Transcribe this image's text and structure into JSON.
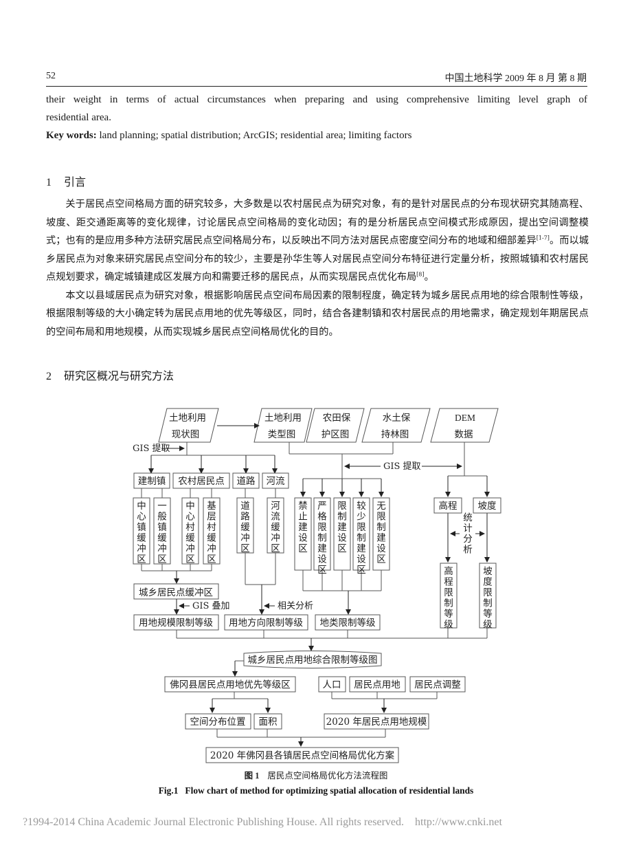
{
  "header": {
    "page_number": "52",
    "journal": "中国土地科学  2009 年 8 月  第 8 期"
  },
  "abstract_tail": {
    "line1": "their weight in terms of actual circumstances when preparing and using comprehensive limiting level graph of",
    "line2": "residential area.",
    "keywords_label": "Key words:",
    "keywords": " land planning; spatial distribution; ArcGIS; residential area; limiting factors"
  },
  "sections": {
    "s1": {
      "number": "1",
      "title": "引言"
    },
    "s2": {
      "number": "2",
      "title": "研究区概况与研究方法"
    }
  },
  "body": {
    "p1_a": "关于居民点空间格局方面的研究较多，大多数是以农村居民点为研究对象，有的是针对居民点的分布现状研究其随高程、坡度、距交通距离等的变化规律，讨论居民点空间格局的变化动因；有的是分析居民点空间模式形成原因，提出空间调整模式；也有的是应用多种方法研究居民点空间格局分布，以反映出不同方法对居民点密度空间分布的地域和细部差异",
    "p1_ref1": "[1-7]",
    "p1_b": "。而以城乡居民点为对象来研究居民点空间分布的较少，主要是孙华生等人对居民点空间分布特征进行定量分析，按照城镇和农村居民点规划要求，确定城镇建成区发展方向和需要迁移的居民点，从而实现居民点优化布局",
    "p1_ref2": "[8]",
    "p1_c": "。",
    "p2": "本文以县域居民点为研究对象，根据影响居民点空间布局因素的限制程度，确定转为城乡居民点用地的综合限制性等级，根据限制等级的大小确定转为居民点用地的优先等级区，同时，结合各建制镇和农村居民点的用地需求，确定规划年期居民点的空间布局和用地规模，从而实现城乡居民点空间格局优化的目的。"
  },
  "flowchart": {
    "inputs": {
      "current_landuse": [
        "土地利用",
        "现状图"
      ],
      "landuse_type": [
        "土地利用",
        "类型图"
      ],
      "farmland": [
        "农田保",
        "护区图"
      ],
      "soil_water": [
        "水土保",
        "持林图"
      ],
      "dem": [
        "DEM",
        "数据"
      ]
    },
    "labels": {
      "gis_extract_left": "GIS 提取",
      "gis_extract_mid": "GIS 提取",
      "stat_analysis": [
        "统",
        "计",
        "分",
        "析"
      ],
      "gis_overlay": "GIS 叠加",
      "correlation": "相关分析"
    },
    "categories": {
      "town": "建制镇",
      "village": "农村居民点",
      "road": "道路",
      "river": "河流",
      "elevation": "高程",
      "slope": "坡度"
    },
    "buffers": {
      "central_town": "中心镇缓冲区",
      "general_town": "一般镇缓冲区",
      "central_village": "中心村缓冲区",
      "basic_village": "基层村缓冲区",
      "road": "道路缓冲区",
      "river": "河流缓冲区"
    },
    "zones": {
      "forbidden": "禁止建设区",
      "strict": "严格限制建设区",
      "limited": "限制建设区",
      "less": "较少限制建设区",
      "none": "无限制建设区"
    },
    "dem_levels": {
      "elevation": "高程限制等级",
      "slope": "坡度限制等级"
    },
    "merged_buffer": "城乡居民点缓冲区",
    "levels": {
      "scale": "用地规模限制等级",
      "direction": "用地方向限制等级",
      "landtype": "地类限制等级"
    },
    "composite_map": "城乡居民点用地综合限制等级图",
    "priority_zone": "佛冈县居民点用地优先等级区",
    "demand": {
      "population": "人口",
      "land": "居民点用地",
      "adjust": "居民点调整"
    },
    "outputs": {
      "location": "空间分布位置",
      "area": "面积",
      "scale2020": "2020 年居民点用地规模"
    },
    "final": "2020 年佛冈县各镇居民点空间格局优化方案"
  },
  "caption": {
    "cn_label": "图 1",
    "cn_title": "居民点空间格局优化方法流程图",
    "en": "Fig.1   Flow chart of method for optimizing spatial allocation of residential lands"
  },
  "footer": "?1994-2014 China Academic Journal Electronic Publishing House. All rights reserved.    http://www.cnki.net"
}
